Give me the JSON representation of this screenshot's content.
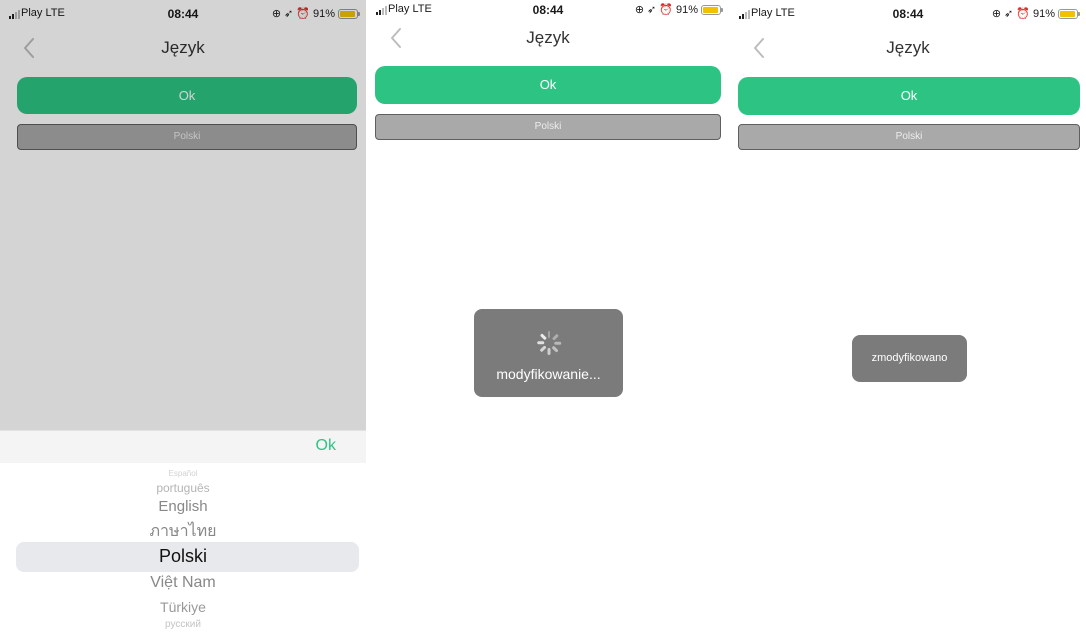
{
  "status_bar": {
    "carrier": "Play",
    "network": "LTE",
    "time": "08:44",
    "battery": "91%",
    "battery_level": 0.91
  },
  "screen": {
    "title": "Język",
    "ok_button": "Ok",
    "language_value": "Polski"
  },
  "picker": {
    "confirm": "Ok",
    "options": [
      "Español",
      "português",
      "English",
      "ภาษาไทย",
      "Polski",
      "Việt Nam",
      "Türkiye",
      "русский"
    ],
    "selected": "Polski"
  },
  "toasts": {
    "loading": "modyfikowanie...",
    "done": "zmodyfikowano"
  },
  "colors": {
    "accent": "#2dc483",
    "toast_bg": "#7b7b7b",
    "battery": "#f2c200"
  }
}
